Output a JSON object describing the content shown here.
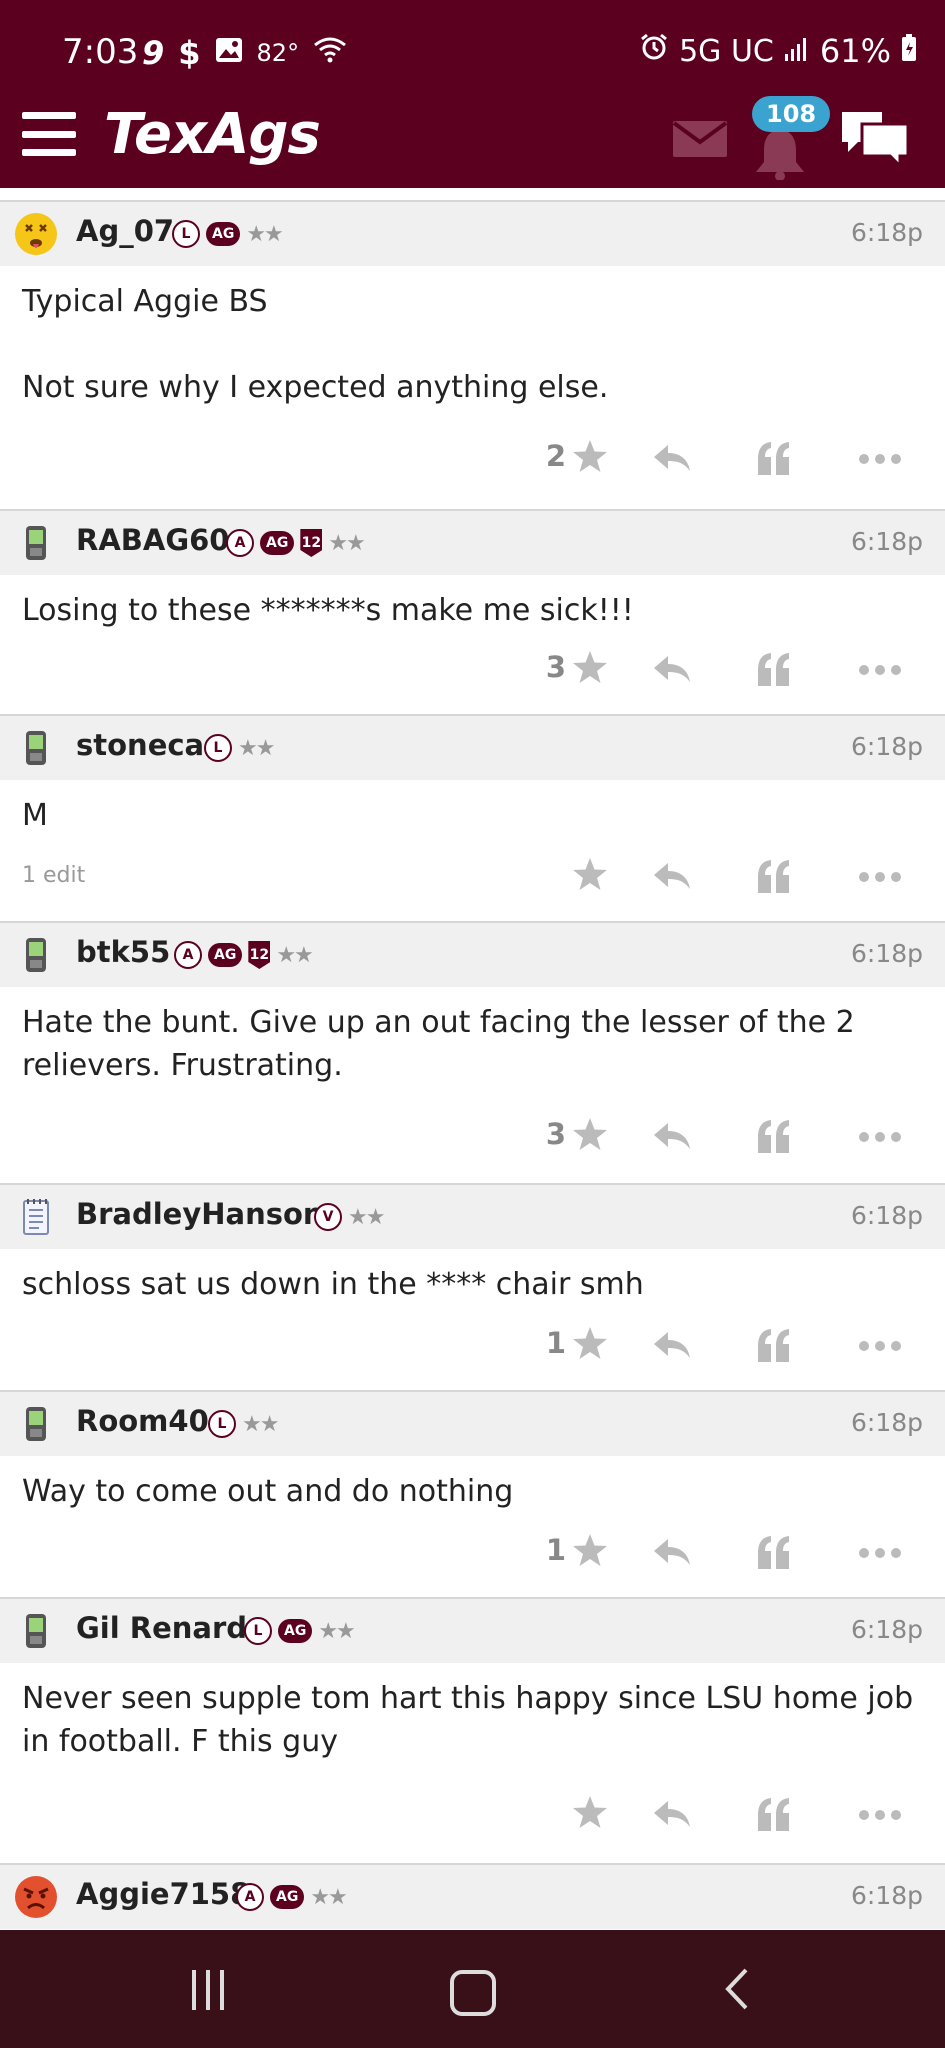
{
  "status_bar": {
    "time": "7:03",
    "left_icons": [
      "9",
      "$",
      "image-icon",
      "82°",
      "wifi-icon"
    ],
    "network": "5G UC",
    "battery": "61%"
  },
  "header": {
    "logo": "TexAgs",
    "notif_count": "108"
  },
  "posts": [
    {
      "user": "Ag_07",
      "tags": [
        "L",
        "AG"
      ],
      "time": "6:18p",
      "body": "Typical Aggie BS\n\nNot sure why I expected anything else.",
      "likes": "2",
      "edit": ""
    },
    {
      "user": "RABAG60",
      "tags": [
        "A",
        "AG",
        "12"
      ],
      "time": "6:18p",
      "body": "Losing to these *******s make me sick!!!",
      "likes": "3",
      "edit": ""
    },
    {
      "user": "stoneca",
      "tags": [
        "L"
      ],
      "time": "6:18p",
      "body": "M",
      "likes": "",
      "edit": "1 edit"
    },
    {
      "user": "btk55",
      "tags": [
        "A",
        "AG",
        "12"
      ],
      "time": "6:18p",
      "body": "Hate the bunt. Give up an out facing the lesser of the 2 relievers. Frustrating.",
      "likes": "3",
      "edit": ""
    },
    {
      "user": "BradleyHanson",
      "tags": [
        "V"
      ],
      "time": "6:18p",
      "body": "schloss sat us down in the **** chair smh",
      "likes": "1",
      "edit": ""
    },
    {
      "user": "Room40",
      "tags": [
        "L"
      ],
      "time": "6:18p",
      "body": "Way to come out and do nothing",
      "likes": "1",
      "edit": ""
    },
    {
      "user": "Gil Renard",
      "tags": [
        "L",
        "AG"
      ],
      "time": "6:18p",
      "body": "Never seen supple tom hart this happy since LSU home job in football. F this guy",
      "likes": "",
      "edit": ""
    },
    {
      "user": "Aggie7158",
      "tags": [
        "A",
        "AG"
      ],
      "time": "6:18p",
      "body": "",
      "likes": "",
      "edit": ""
    }
  ],
  "colors": {
    "maroon": "#5c0020",
    "navbar": "#3a1018",
    "badge": "#3ba3d0"
  }
}
